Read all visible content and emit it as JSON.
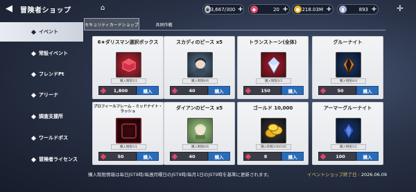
{
  "header": {
    "back_icon": "back-arrow-icon",
    "title": "冒険者ショップ",
    "home_icon": "home-icon"
  },
  "currencies": [
    {
      "icon": "stamina-icon",
      "value": "3,667/300",
      "color": "#c9ccd4"
    },
    {
      "icon": "red-gem-icon",
      "value": "20",
      "color": "#e04868"
    },
    {
      "icon": "gold-coin-icon",
      "value": "218.03M",
      "color": "#e8b020"
    },
    {
      "icon": "ticket-icon",
      "value": "893",
      "color": "#a8b4d8"
    }
  ],
  "sidebar": {
    "items": [
      {
        "label": "イベント",
        "active": true
      },
      {
        "label": "常設イベント"
      },
      {
        "label": "フレンドPt"
      },
      {
        "label": "アリーナ"
      },
      {
        "label": "調査支援所"
      },
      {
        "label": "ワールドボス"
      },
      {
        "label": "冒険者ライセンス"
      }
    ]
  },
  "tabs": [
    {
      "label": "セキュリティカードショップ",
      "active": true
    },
    {
      "label": "共同作戦"
    }
  ],
  "cards": [
    {
      "name": "6★ダリスマン選択ボックス",
      "limit": "購入制限1/1",
      "price": "1,800",
      "buy": "購入",
      "icon": "red-box-icon"
    },
    {
      "name": "スカディのピース x5",
      "limit": "購入制限6/6",
      "price": "40",
      "buy": "購入",
      "icon": "skadi-portrait-icon"
    },
    {
      "name": "トランストーン(全体)",
      "limit": "購入制限3/3",
      "price": "150",
      "buy": "購入",
      "icon": "transtone-icon"
    },
    {
      "name": "グルーナイト",
      "limit": "購入制限4/4",
      "price": "50",
      "buy": "購入",
      "icon": "glue-knight-icon"
    },
    {
      "name": "プロフィールフレーム - ミッドナイト・ラッシュ",
      "limit": "購入制限1/1",
      "price": "50",
      "buy": "購入",
      "icon": "profile-frame-icon"
    },
    {
      "name": "ダイアンのピース x5",
      "limit": "購入制限6/6",
      "price": "40",
      "buy": "購入",
      "icon": "diane-portrait-icon"
    },
    {
      "name": "ゴールド 10,000",
      "limit": "購入制限100/100",
      "price": "8",
      "buy": "購入",
      "icon": "gold-coins-icon"
    },
    {
      "name": "アーマーグルーナイト",
      "limit": "購入制限1/1",
      "price": "100",
      "buy": "購入",
      "icon": "armor-glue-knight-icon"
    }
  ],
  "footer": {
    "note": "購入制限情報は毎日JST9時/毎週月曜日のJST9時/毎月1日のJST9時を基準に更新されます。",
    "expire_label": "イベントショップ終了日 :",
    "expire_date": "2026.06.09"
  }
}
